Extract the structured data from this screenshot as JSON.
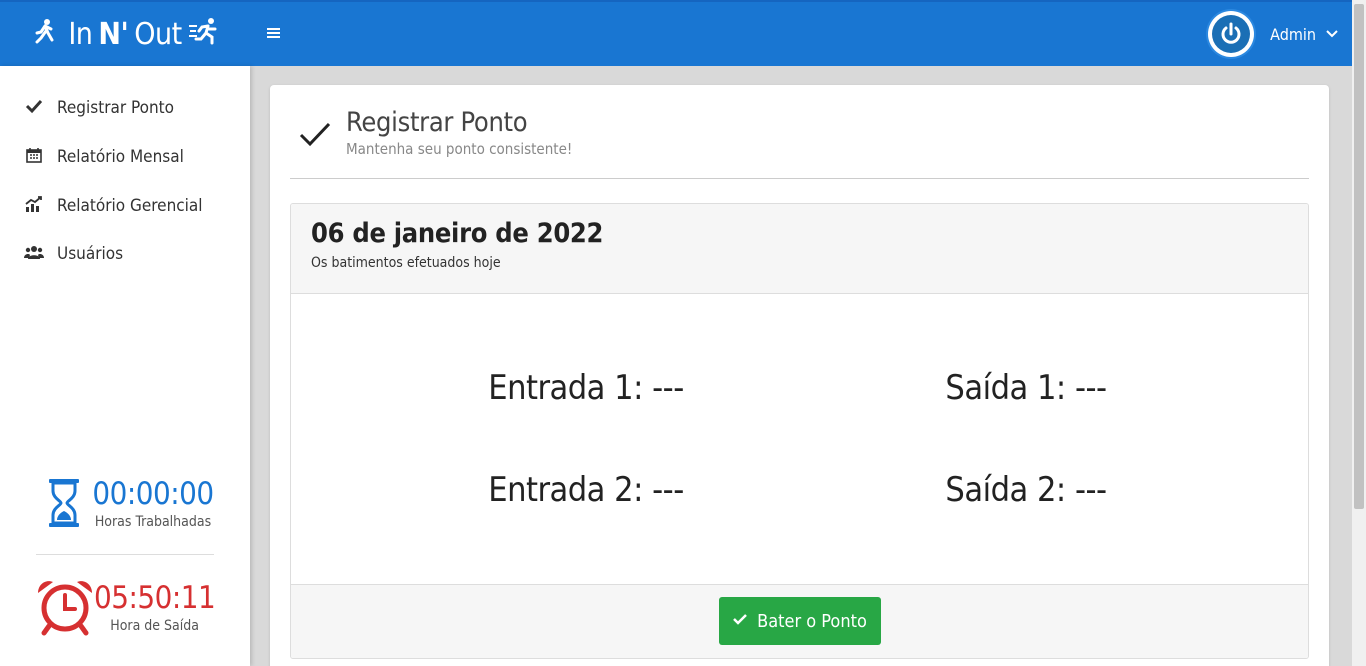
{
  "header": {
    "logo_left": "In",
    "logo_mid": "N'",
    "logo_right": "Out",
    "menu_icon": "hamburger-icon",
    "user_name": "Admin",
    "colors": {
      "primary": "#1976d2"
    }
  },
  "sidebar": {
    "items": [
      {
        "label": "Registrar Ponto",
        "icon": "check-icon"
      },
      {
        "label": "Relatório Mensal",
        "icon": "calendar-icon"
      },
      {
        "label": "Relatório Gerencial",
        "icon": "chart-icon"
      },
      {
        "label": "Usuários",
        "icon": "users-icon"
      }
    ],
    "hours_worked": {
      "value": "00:00:00",
      "label": "Horas Trabalhadas",
      "color": "#1976d2"
    },
    "exit_time": {
      "value": "05:50:11",
      "label": "Hora de Saída",
      "color": "#d63031"
    }
  },
  "page": {
    "title": "Registrar Ponto",
    "subtitle": "Mantenha seu ponto consistente!"
  },
  "panel": {
    "date": "06 de janeiro de 2022",
    "date_sub": "Os batimentos efetuados hoje",
    "entries": {
      "entrada1": "Entrada 1: ---",
      "saida1": "Saída 1: ---",
      "entrada2": "Entrada 2: ---",
      "saida2": "Saída 2: ---"
    },
    "button_label": "Bater o Ponto",
    "button_color": "#28a745"
  }
}
